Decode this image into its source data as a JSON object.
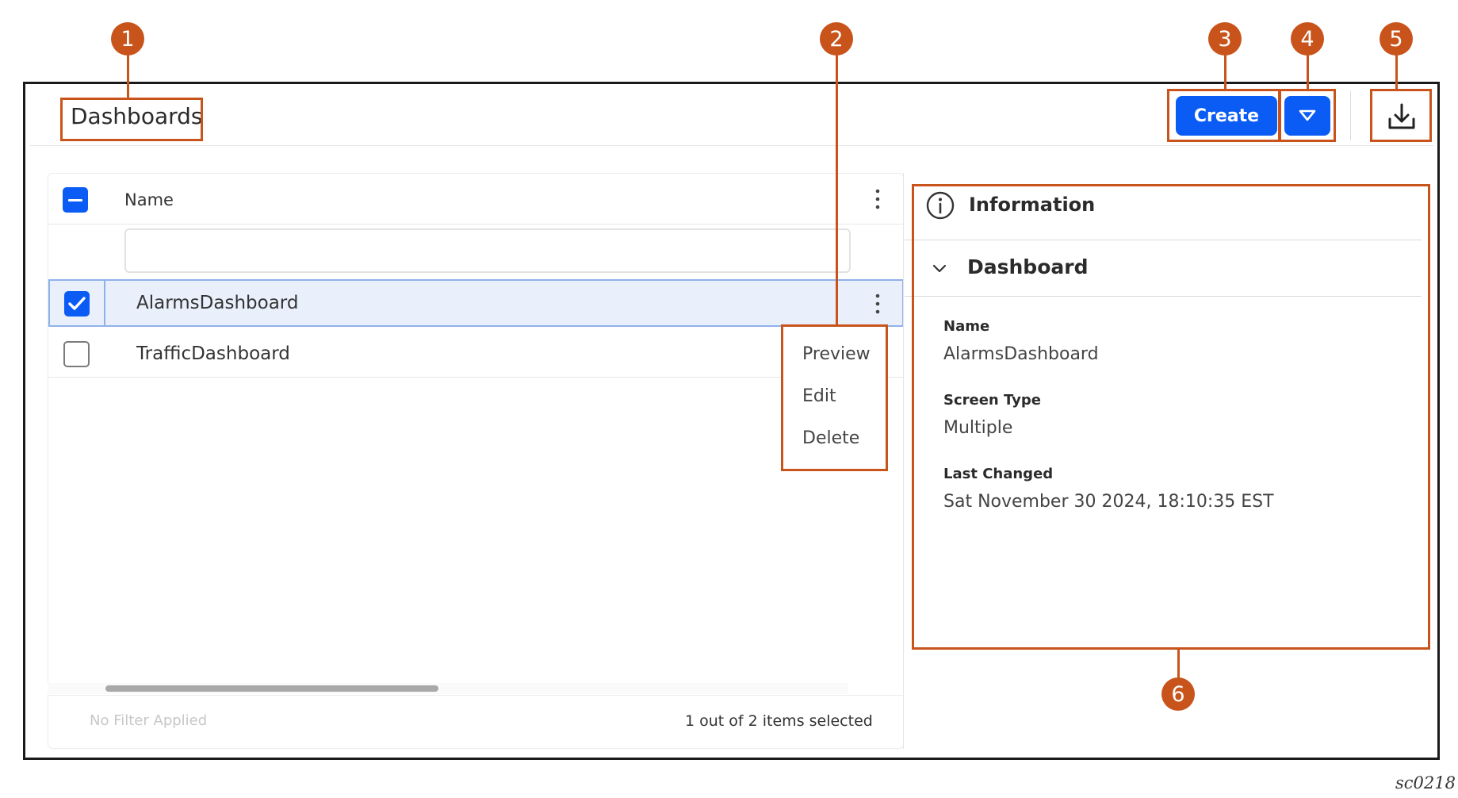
{
  "header": {
    "title": "Dashboards",
    "create_label": "Create"
  },
  "table": {
    "column_name": "Name",
    "filter_value": "",
    "rows": [
      {
        "label": "AlarmsDashboard",
        "checked": true
      },
      {
        "label": "TrafficDashboard",
        "checked": false
      }
    ],
    "footer_filter": "No Filter Applied",
    "footer_selection": "1 out of 2 items selected"
  },
  "context_menu": {
    "items": [
      "Preview",
      "Edit",
      "Delete"
    ]
  },
  "info_panel": {
    "title": "Information",
    "section_title": "Dashboard",
    "fields": [
      {
        "label": "Name",
        "value": "AlarmsDashboard"
      },
      {
        "label": "Screen Type",
        "value": "Multiple"
      },
      {
        "label": "Last Changed",
        "value": "Sat November 30 2024, 18:10:35 EST"
      }
    ]
  },
  "callouts": [
    "1",
    "2",
    "3",
    "4",
    "5",
    "6"
  ],
  "figure_id": "sc0218",
  "colors": {
    "accent": "#0b5cf5",
    "callout": "#c8541c",
    "selected_row": "#e9f0fc"
  },
  "icons": [
    "dropdown-triangle-icon",
    "download-icon",
    "kebab-menu-icon",
    "checkbox-checked-icon",
    "info-icon",
    "chevron-down-icon"
  ]
}
